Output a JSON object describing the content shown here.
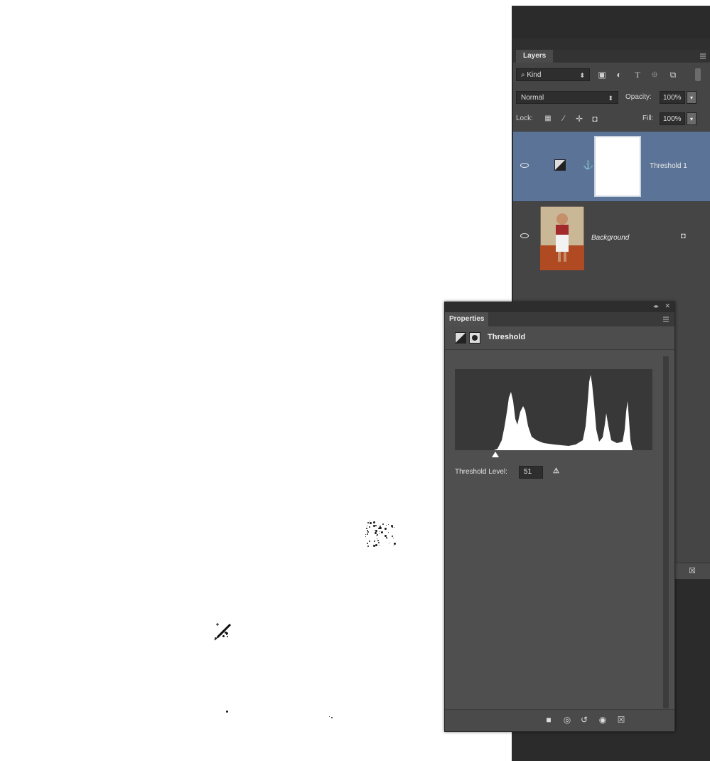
{
  "layers_panel": {
    "tab_label": "Layers",
    "filter": {
      "kind_label": "Kind"
    },
    "blend_mode": "Normal",
    "opacity_label": "Opacity:",
    "opacity_value": "100%",
    "lock_label": "Lock:",
    "fill_label": "Fill:",
    "fill_value": "100%",
    "layers": [
      {
        "name": "Threshold 1",
        "selected": true
      },
      {
        "name": "Background",
        "selected": false,
        "locked": true
      }
    ]
  },
  "properties_panel": {
    "tab_label": "Properties",
    "adjustment_title": "Threshold",
    "threshold_label": "Threshold Level:",
    "threshold_value": "51"
  },
  "colors": {
    "panel_bg": "#454545",
    "selected_layer": "#5b7397",
    "dark_dock": "#2b2b2b",
    "canvas": "#ffffff"
  },
  "icons": [
    "search-icon",
    "image-filter-icon",
    "adjustment-filter-icon",
    "type-filter-icon",
    "shape-filter-icon",
    "smart-object-filter-icon",
    "lock-transparent-icon",
    "lock-pixels-icon",
    "lock-position-icon",
    "lock-all-icon",
    "eye-icon",
    "link-icon",
    "padlock-icon",
    "trash-icon",
    "threshold-adjustment-icon",
    "mask-icon",
    "clip-to-layer-icon",
    "view-previous-icon",
    "reset-icon",
    "visibility-icon",
    "eyedropper-icon",
    "warning-icon"
  ]
}
